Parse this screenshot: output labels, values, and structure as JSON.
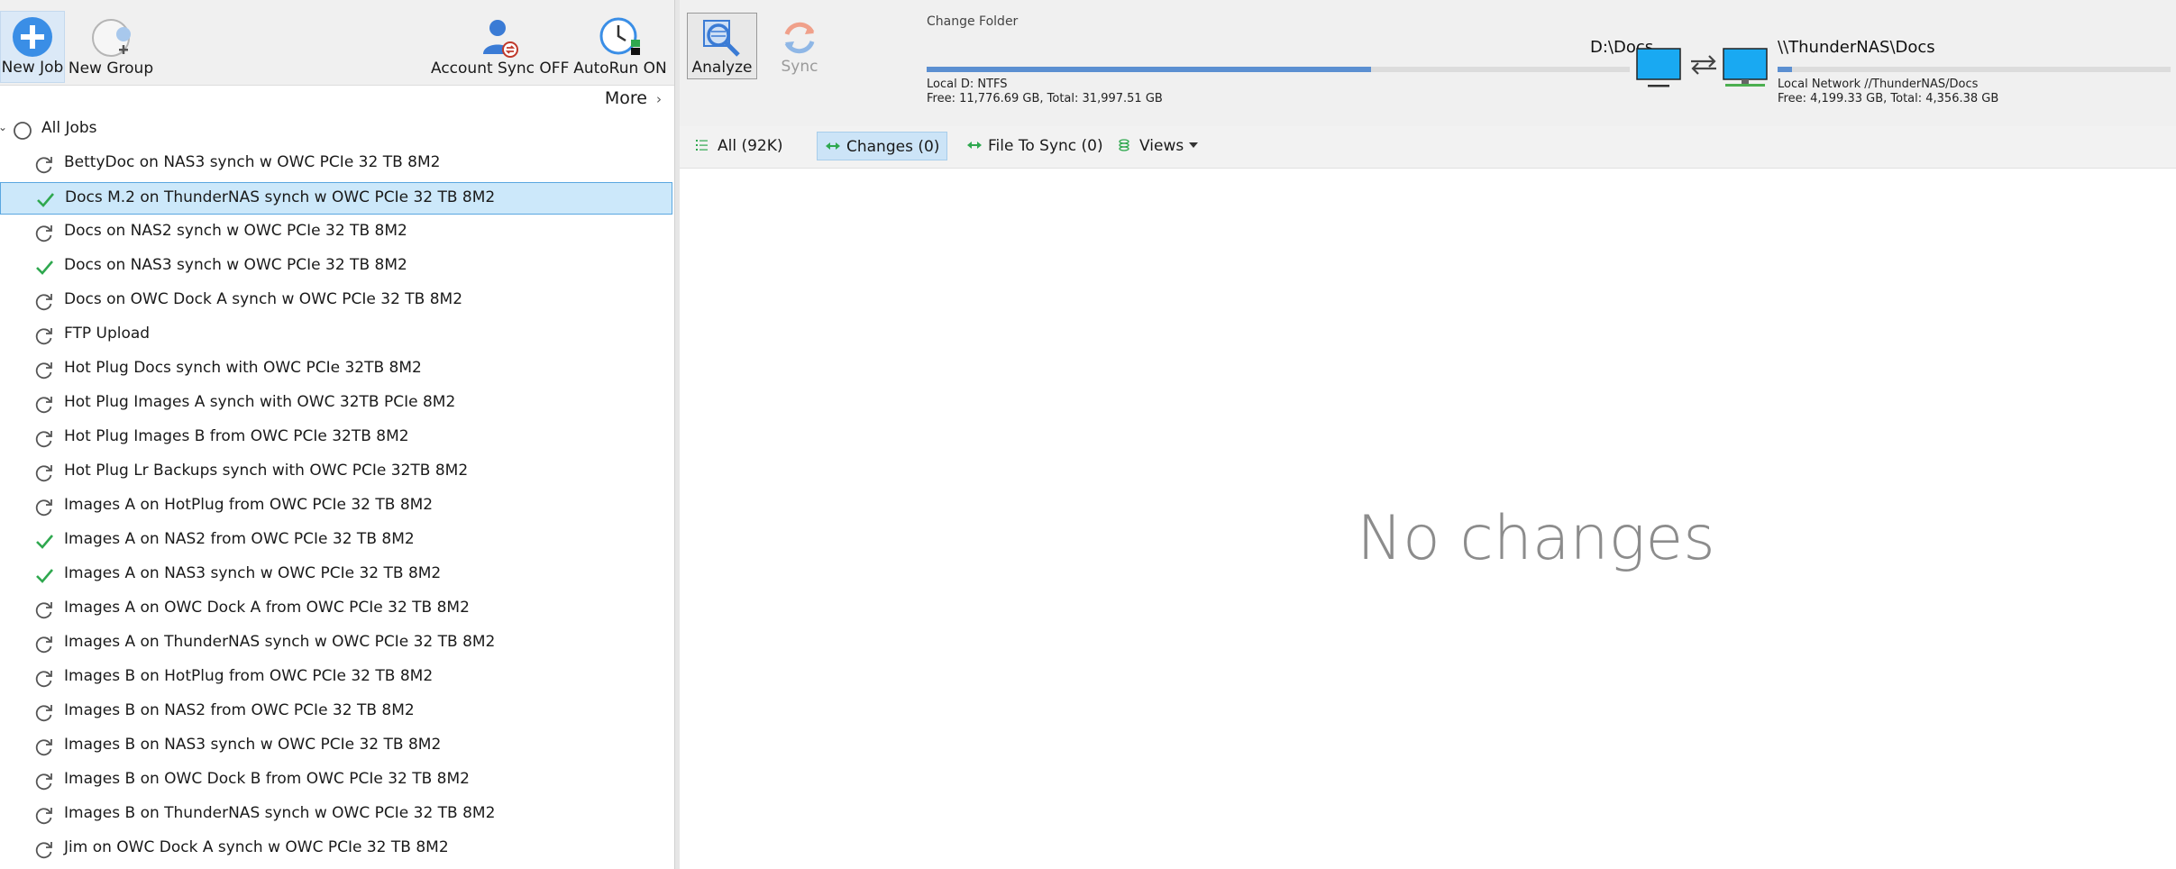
{
  "left_toolbar": {
    "new_job": "New Job",
    "new_group": "New Group",
    "account_sync": "Account Sync OFF",
    "autorun": "AutoRun ON"
  },
  "more": {
    "label": "More"
  },
  "jobs": {
    "all_label": "All Jobs",
    "items": [
      {
        "label": "BettyDoc on NAS3 synch w OWC PCIe 32 TB 8M2",
        "status": "refresh",
        "selected": false
      },
      {
        "label": "Docs M.2 on ThunderNAS synch w OWC PCIe 32 TB 8M2",
        "status": "check",
        "selected": true
      },
      {
        "label": "Docs on NAS2 synch w OWC PCIe 32 TB 8M2",
        "status": "refresh",
        "selected": false
      },
      {
        "label": "Docs on NAS3 synch w OWC PCIe 32 TB 8M2",
        "status": "check",
        "selected": false
      },
      {
        "label": "Docs on OWC Dock A synch w OWC PCIe 32 TB 8M2",
        "status": "refresh",
        "selected": false
      },
      {
        "label": "FTP Upload",
        "status": "refresh",
        "selected": false
      },
      {
        "label": "Hot Plug Docs synch with OWC PCIe 32TB 8M2",
        "status": "refresh",
        "selected": false
      },
      {
        "label": "Hot Plug Images A synch with OWC 32TB PCIe 8M2",
        "status": "refresh",
        "selected": false
      },
      {
        "label": "Hot Plug Images B from OWC PCIe 32TB 8M2",
        "status": "refresh",
        "selected": false
      },
      {
        "label": "Hot Plug Lr Backups synch with OWC PCIe 32TB 8M2",
        "status": "refresh",
        "selected": false
      },
      {
        "label": "Images A on HotPlug from OWC PCIe 32 TB 8M2",
        "status": "refresh",
        "selected": false
      },
      {
        "label": "Images A on NAS2 from OWC PCIe 32 TB 8M2",
        "status": "check",
        "selected": false
      },
      {
        "label": "Images A on NAS3 synch w OWC PCIe 32 TB 8M2",
        "status": "check",
        "selected": false
      },
      {
        "label": "Images A on OWC Dock A from OWC PCIe 32 TB 8M2",
        "status": "refresh",
        "selected": false
      },
      {
        "label": "Images A on ThunderNAS synch w OWC PCIe 32 TB 8M2",
        "status": "refresh",
        "selected": false
      },
      {
        "label": "Images B on HotPlug from OWC PCIe 32 TB 8M2",
        "status": "refresh",
        "selected": false
      },
      {
        "label": "Images B on NAS2 from OWC PCIe 32 TB 8M2",
        "status": "refresh",
        "selected": false
      },
      {
        "label": "Images B on NAS3 synch w OWC PCIe 32 TB 8M2",
        "status": "refresh",
        "selected": false
      },
      {
        "label": "Images B on OWC Dock B from OWC PCIe 32 TB 8M2",
        "status": "refresh",
        "selected": false
      },
      {
        "label": "Images B on ThunderNAS synch w OWC PCIe 32 TB 8M2",
        "status": "refresh",
        "selected": false
      },
      {
        "label": "Jim on OWC Dock A synch w OWC PCIe 32 TB 8M2",
        "status": "refresh",
        "selected": false
      }
    ]
  },
  "right_toolbar": {
    "analyze": "Analyze",
    "sync": "Sync",
    "change_folder": "Change Folder"
  },
  "left_side": {
    "path": "D:\\Docs",
    "info1": "Local D: NTFS",
    "info2": "Free: 11,776.69 GB, Total: 31,997.51 GB",
    "used_fraction": 0.632
  },
  "right_side": {
    "path": "\\\\ThunderNAS\\Docs",
    "info1": "Local Network //ThunderNAS/Docs",
    "info2": "Free: 4,199.33 GB, Total: 4,356.38 GB",
    "used_fraction": 0.036
  },
  "filters": {
    "all": "All (92K)",
    "changes": "Changes (0)",
    "file_to_sync": "File To Sync (0)",
    "views": "Views"
  },
  "main": {
    "empty_message": "No changes"
  },
  "colors": {
    "accent": "#3a8ee6",
    "check": "#2fa84f",
    "selected_row": "#cce8fa",
    "monitor": "#19a9f2"
  }
}
